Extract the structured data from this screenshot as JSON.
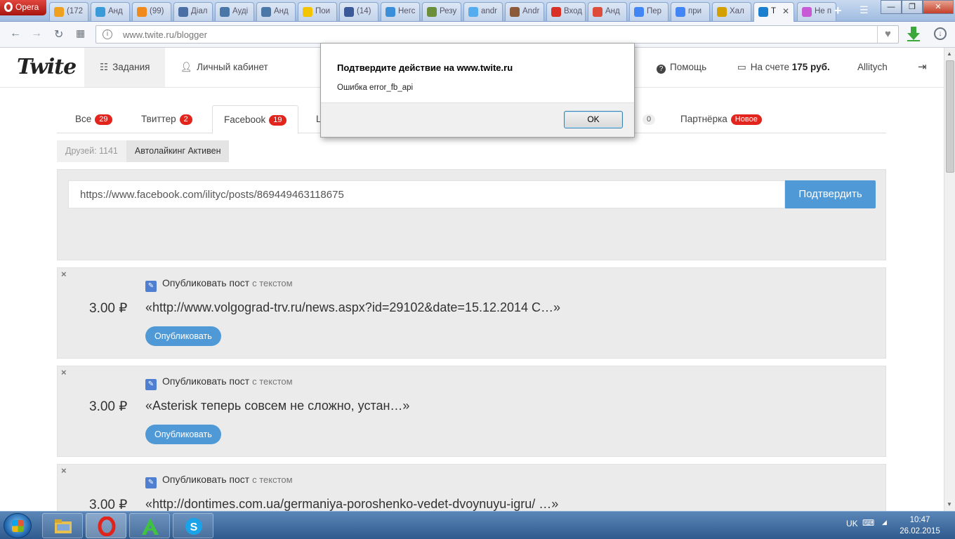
{
  "browser": {
    "opera_label": "Opera",
    "tabs": [
      {
        "label": "(172",
        "color": "#f0a020"
      },
      {
        "label": "Анд",
        "color": "#3a9bd8"
      },
      {
        "label": "(99)",
        "color": "#f08a1c"
      },
      {
        "label": "Діал",
        "color": "#4a6fa5"
      },
      {
        "label": "Ауді",
        "color": "#4a76a8"
      },
      {
        "label": "Анд",
        "color": "#4a76a8"
      },
      {
        "label": "Пои",
        "color": "#f5c400"
      },
      {
        "label": "(14)",
        "color": "#3b5998"
      },
      {
        "label": "Негс",
        "color": "#3a8fd8"
      },
      {
        "label": "Резу",
        "color": "#6b8e3a"
      },
      {
        "label": "andr",
        "color": "#55acee"
      },
      {
        "label": "Andr",
        "color": "#8a5a3a"
      },
      {
        "label": "Вход",
        "color": "#d93025"
      },
      {
        "label": "Анд",
        "color": "#dd4b39"
      },
      {
        "label": "Пер",
        "color": "#4285f4"
      },
      {
        "label": "при",
        "color": "#4285f4"
      },
      {
        "label": "Хал",
        "color": "#d4a000"
      },
      {
        "label": "T",
        "color": "#1a7fcf",
        "active": true
      },
      {
        "label": "Не п",
        "color": "#c85ad6"
      }
    ],
    "url": "www.twite.ru/blogger",
    "win_minimize": "—",
    "win_restore": "❐",
    "win_close": "✕"
  },
  "header": {
    "logo": "Twite",
    "nav_tasks": "Задания",
    "nav_cabinet": "Личный кабинет",
    "help": "Помощь",
    "balance_prefix": "На счете",
    "balance_value": "175 руб.",
    "username": "Allitych"
  },
  "tabs": [
    {
      "label": "Все",
      "badge": "29"
    },
    {
      "label": "Твиттер",
      "badge": "2"
    },
    {
      "label": "Facebook",
      "badge": "19"
    },
    {
      "label": "L",
      "badge": ""
    },
    {
      "label": "",
      "badge": "0"
    },
    {
      "label": "Партнёрка",
      "badge": "Новое"
    }
  ],
  "friends": {
    "count_label": "Друзей: 1141",
    "autolike_label": "Автолайкинг Активен"
  },
  "link_form": {
    "value": "https://www.facebook.com/ilityc/posts/869449463118675",
    "confirm_label": "Подтвердить"
  },
  "tasks": [
    {
      "price": "3.00 ₽",
      "title": "Опубликовать пост",
      "subtitle": "с текстом",
      "text": "«http://www.volgograd-trv.ru/news.aspx?id=29102&date=15.12.2014 С…»",
      "button": "Опубликовать"
    },
    {
      "price": "3.00 ₽",
      "title": "Опубликовать пост",
      "subtitle": "с текстом",
      "text": "«Asterisk теперь совсем не сложно, устан…»",
      "button": "Опубликовать"
    },
    {
      "price": "3.00 ₽",
      "title": "Опубликовать пост",
      "subtitle": "с текстом",
      "text": "«http://dontimes.com.ua/germaniya-poroshenko-vedet-dvoynuyu-igru/ …»",
      "button": "Опубликовать"
    }
  ],
  "dialog": {
    "title": "Подтвердите действие на www.twite.ru",
    "message": "Ошибка error_fb_api",
    "ok_label": "OK"
  },
  "taskbar": {
    "lang": "UK",
    "time": "10:47",
    "date": "26.02.2015"
  }
}
